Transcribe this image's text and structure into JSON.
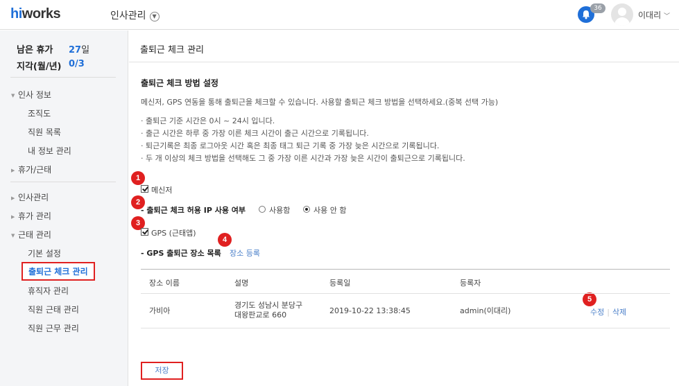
{
  "header": {
    "logo_hi": "hi",
    "logo_works": "works",
    "app_menu": "인사관리",
    "notification_count": "36",
    "user_name": "이대리",
    "user_chevron": "﹀"
  },
  "sidebar": {
    "stats": [
      {
        "label": "남은 휴가",
        "value": "27",
        "unit": "일"
      },
      {
        "label": "지각(월/년)",
        "value": "0/3",
        "unit": ""
      }
    ],
    "sections": [
      {
        "label": "인사 정보",
        "expanded": true,
        "items": [
          "조직도",
          "직원 목록",
          "내 정보 관리"
        ]
      },
      {
        "label": "휴가/근태",
        "expanded": false,
        "items": []
      },
      {
        "label": "인사관리",
        "expanded": false,
        "items": []
      },
      {
        "label": "휴가 관리",
        "expanded": false,
        "items": []
      },
      {
        "label": "근태 관리",
        "expanded": true,
        "items": [
          "기본 설정",
          "출퇴근 체크 관리",
          "휴직자 관리",
          "직원 근태 관리",
          "직원 근무 관리"
        ]
      }
    ],
    "active_item": "출퇴근 체크 관리"
  },
  "main": {
    "page_title": "출퇴근 체크 관리",
    "section_title": "출퇴근 체크 방법 설정",
    "description": "메신저, GPS 연동을 통해 출퇴근을 체크할 수 있습니다. 사용할 출퇴근 체크 방법을 선택하세요.(중복 선택 가능)",
    "bullets": [
      "· 출퇴근 기준 시간은 0시 ~ 24시 입니다.",
      "· 출근 시간은 하루 중 가장 이른 체크 시간이 출근 시간으로 기록됩니다.",
      "· 퇴근기록은 최종 로그아웃 시간 혹은 최종 태그 퇴근 기록 중 가장 늦은 시간으로 기록됩니다.",
      "· 두 개 이상의 체크 방법을 선택해도 그 중 가장 이른 시간과 가장 늦은 시간이 출퇴근으로 기록됩니다."
    ],
    "markers": [
      "1",
      "2",
      "3",
      "4",
      "5"
    ],
    "messenger_checkbox": {
      "label": "메신저",
      "checked": true
    },
    "ip_option": {
      "title": "- 출퇴근 체크 허용 IP 사용 여부",
      "options": [
        {
          "label": "사용함",
          "selected": false
        },
        {
          "label": "사용 안 함",
          "selected": true
        }
      ]
    },
    "gps_checkbox": {
      "label": "GPS (근태앱)",
      "checked": true
    },
    "gps_list": {
      "title": "- GPS 출퇴근 장소 목록",
      "register_link": "장소 등록"
    },
    "table": {
      "columns": [
        "장소 이름",
        "설명",
        "등록일",
        "등록자"
      ],
      "rows": [
        {
          "name": "가비아",
          "desc_line1": "경기도 성남시 분당구",
          "desc_line2": "대왕판교로 660",
          "date": "2019-10-22 13:38:45",
          "registrant": "admin(이대리)",
          "edit": "수정",
          "delete": "삭제"
        }
      ]
    },
    "save_button": "저장"
  },
  "colors": {
    "accent": "#1f6fd8",
    "marker": "#e02020",
    "link": "#4a7fc9"
  }
}
